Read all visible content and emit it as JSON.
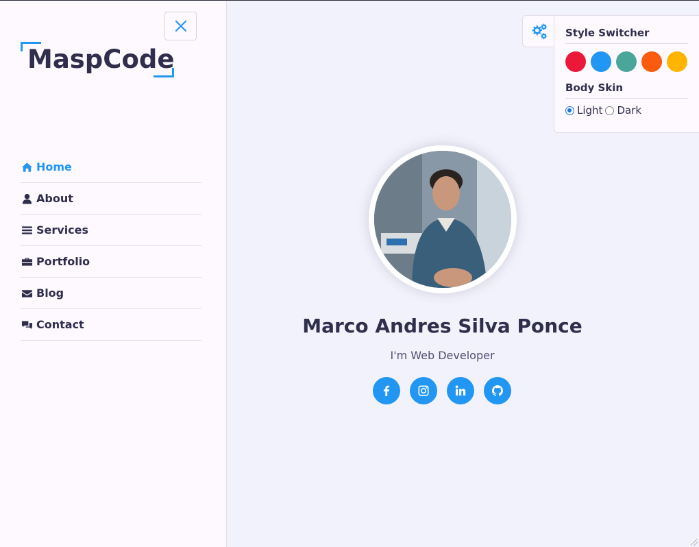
{
  "sidebar": {
    "logo": "MaspCode",
    "close_icon": "close-icon",
    "items": [
      {
        "label": "Home",
        "icon": "home-icon",
        "active": true
      },
      {
        "label": "About",
        "icon": "user-icon",
        "active": false
      },
      {
        "label": "Services",
        "icon": "list-icon",
        "active": false
      },
      {
        "label": "Portfolio",
        "icon": "briefcase-icon",
        "active": false
      },
      {
        "label": "Blog",
        "icon": "envelope-icon",
        "active": false
      },
      {
        "label": "Contact",
        "icon": "comments-icon",
        "active": false
      }
    ]
  },
  "hero": {
    "name": "Marco Andres Silva Ponce",
    "role": "I'm Web Developer",
    "socials": [
      "facebook-icon",
      "instagram-icon",
      "linkedin-icon",
      "github-icon"
    ]
  },
  "switcher": {
    "title": "Style Switcher",
    "colors": [
      "#ec1839",
      "#2196f3",
      "#4aa59b",
      "#fa5b0f",
      "#ffb400"
    ],
    "skin_title": "Body Skin",
    "skin_options": [
      {
        "label": "Light",
        "checked": true
      },
      {
        "label": "Dark",
        "checked": false
      }
    ]
  },
  "theme": {
    "accent": "#2196f3",
    "text": "#302e4d",
    "background": "#f2f2fc"
  }
}
